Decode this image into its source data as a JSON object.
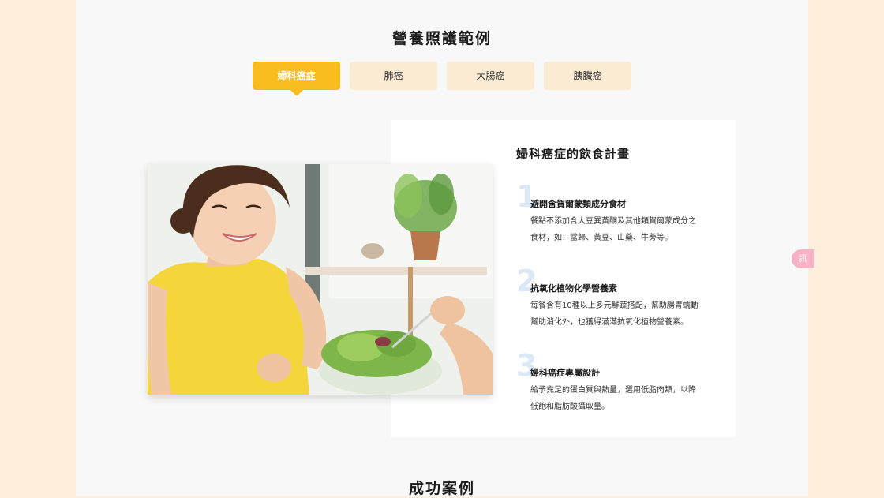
{
  "nutrition_section": {
    "title": "營養照護範例",
    "tabs": [
      {
        "label": "婦科癌症",
        "active": true
      },
      {
        "label": "肺癌",
        "active": false
      },
      {
        "label": "大腸癌",
        "active": false
      },
      {
        "label": "胰臟癌",
        "active": false
      }
    ],
    "plan": {
      "title": "婦科癌症的飲食計畫",
      "items": [
        {
          "number": "1",
          "heading": "避開含賀爾蒙類成分食材",
          "body_line1": "餐點不添加含大豆異黃酮及其他類賀爾蒙成分之",
          "body_line2": "食材，如：當歸、黃豆、山藥、牛蒡等。"
        },
        {
          "number": "2",
          "heading": "抗氧化植物化學營養素",
          "body_line1": "每餐含有10種以上多元鮮蔬搭配，幫助腸胃蠕動",
          "body_line2": "幫助消化外，也獲得滿滿抗氧化植物營養素。"
        },
        {
          "number": "3",
          "heading": "婦科癌症專屬設計",
          "body_line1": "給予充足的蛋白質與熱量，選用低脂肉類，以降",
          "body_line2": "低飽和脂肪酸攝取量。"
        }
      ]
    }
  },
  "success_section": {
    "title": "成功案例"
  },
  "side_badge": {
    "label": "訊"
  },
  "colors": {
    "accent": "#f9bc1f",
    "tab_inactive": "#fbebd2",
    "page_bg": "#f8f8f8",
    "outer_bg": "#fdefdc",
    "number_color": "#dbe8f6",
    "badge": "#f7b2c6"
  }
}
